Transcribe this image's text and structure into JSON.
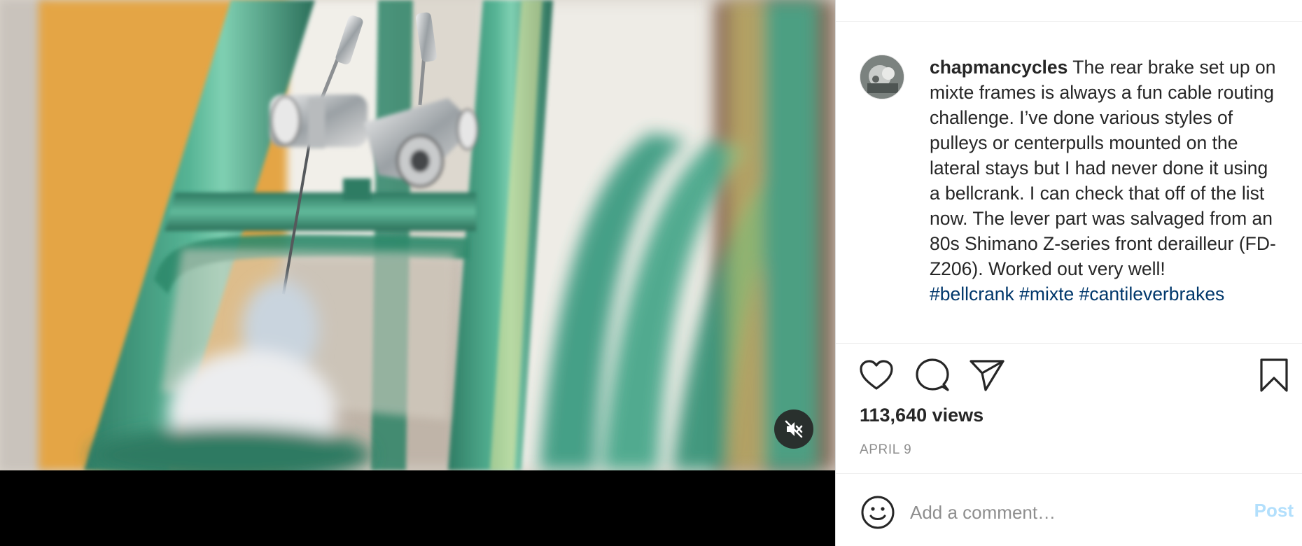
{
  "post": {
    "username": "chapmancycles",
    "caption_body": "The rear brake set up on mixte frames is always a fun cable routing challenge. I’ve done various styles of pulleys or centerpulls mounted on the lateral stays but I had never done it using a bellcrank. I can check that off of the list now. The lever part was salvaged from an 80s Shimano Z-series front derailleur (FD-Z206). Worked out very well!",
    "hashtags": [
      "#bellcrank",
      "#mixte",
      "#cantileverbrakes"
    ],
    "views": "113,640 views",
    "date": "APRIL 9"
  },
  "media": {
    "mute_icon": "speaker-muted-icon",
    "video_muted": true
  },
  "actions": {
    "like_icon": "heart-icon",
    "comment_icon": "speech-bubble-icon",
    "share_icon": "paper-plane-icon",
    "save_icon": "bookmark-icon"
  },
  "comment_box": {
    "emoji_icon": "smiley-icon",
    "placeholder": "Add a comment…",
    "post_label": "Post"
  },
  "colors": {
    "text": "#262626",
    "secondary": "#8e8e8e",
    "hashtag": "#00376b",
    "post_disabled": "#b2dffc",
    "frame_paint": "#3f9a7e"
  }
}
